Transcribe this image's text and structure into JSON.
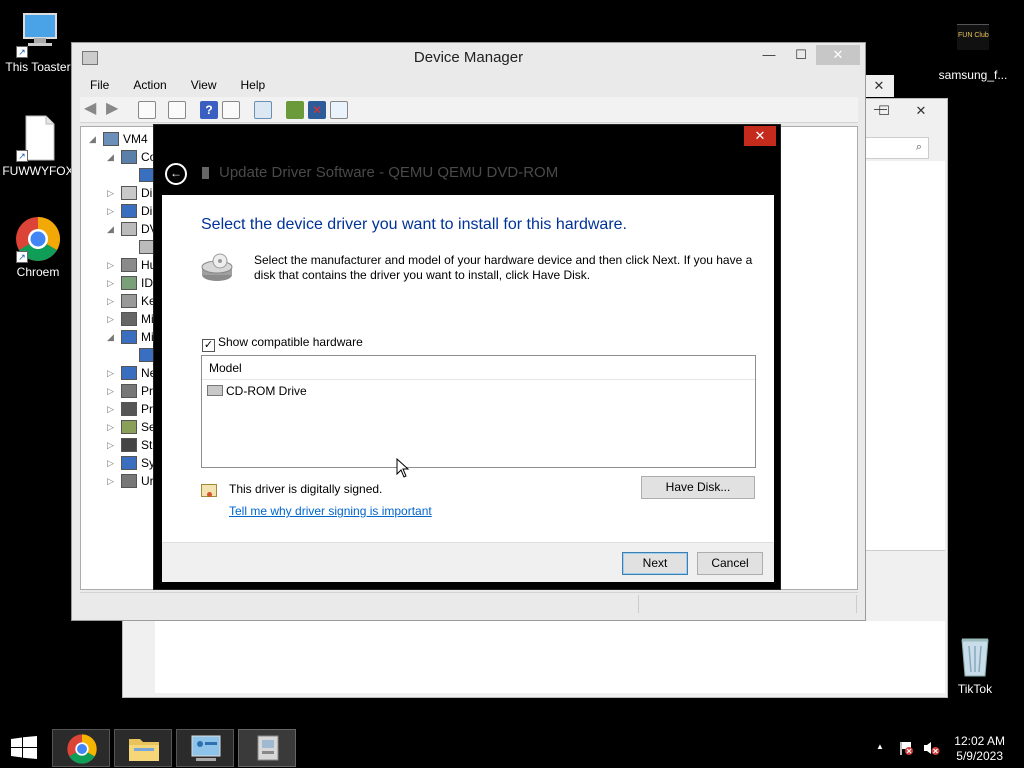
{
  "desktop": {
    "icons": [
      {
        "label": "This Toaster",
        "icon": "computer-icon"
      },
      {
        "label": "FUWWYFOX",
        "icon": "document-icon"
      },
      {
        "label": "Chroem",
        "icon": "chrome-icon"
      },
      {
        "label": "samsung_f...",
        "icon": "app-icon"
      },
      {
        "label": "TikTok",
        "icon": "recycle-bin-icon"
      }
    ],
    "samsung_logo_text": "FUN Club"
  },
  "device_manager": {
    "title": "Device Manager",
    "menu": [
      "File",
      "Action",
      "View",
      "Help"
    ],
    "tree": [
      {
        "label": "VM4",
        "expanded": true
      },
      {
        "label": "Co",
        "expanded": true
      },
      {
        "label": "",
        "child": true
      },
      {
        "label": "Di",
        "expanded": false
      },
      {
        "label": "Di",
        "expanded": false
      },
      {
        "label": "DV",
        "expanded": true
      },
      {
        "label": "",
        "child": true
      },
      {
        "label": "Hu",
        "expanded": false
      },
      {
        "label": "ID",
        "expanded": false
      },
      {
        "label": "Ke",
        "expanded": false
      },
      {
        "label": "Mi",
        "expanded": false
      },
      {
        "label": "Mi",
        "expanded": true
      },
      {
        "label": "",
        "child": true
      },
      {
        "label": "Ne",
        "expanded": false
      },
      {
        "label": "Pri",
        "expanded": false
      },
      {
        "label": "Pr",
        "expanded": false
      },
      {
        "label": "Se",
        "expanded": false
      },
      {
        "label": "St",
        "expanded": false
      },
      {
        "label": "Sy",
        "expanded": false
      },
      {
        "label": "Ur",
        "expanded": false
      }
    ]
  },
  "dialog": {
    "title": "Update Driver Software - QEMU QEMU DVD-ROM",
    "close": "✕",
    "back": "←",
    "heading": "Select the device driver you want to install for this hardware.",
    "description": "Select the manufacturer and model of your hardware device and then click Next. If you have a disk that contains the driver you want to install, click Have Disk.",
    "show_compatible_label": "Show compatible hardware",
    "show_compatible_checked": "✓",
    "list_header": "Model",
    "list_items": [
      "CD-ROM Drive"
    ],
    "signed_text": "This driver is digitally signed.",
    "signing_link": "Tell me why driver signing is important",
    "have_disk": "Have Disk...",
    "next": "Next",
    "cancel": "Cancel"
  },
  "taskbar": {
    "time": "12:02 AM",
    "date": "5/9/2023",
    "tray_up_arrow": "▲"
  },
  "window_buttons": {
    "minimize": "—",
    "maximize": "☐",
    "close": "✕"
  },
  "colors": {
    "accent_close": "#c42b1c",
    "heading_blue": "#003399",
    "link_blue": "#0066cc"
  }
}
